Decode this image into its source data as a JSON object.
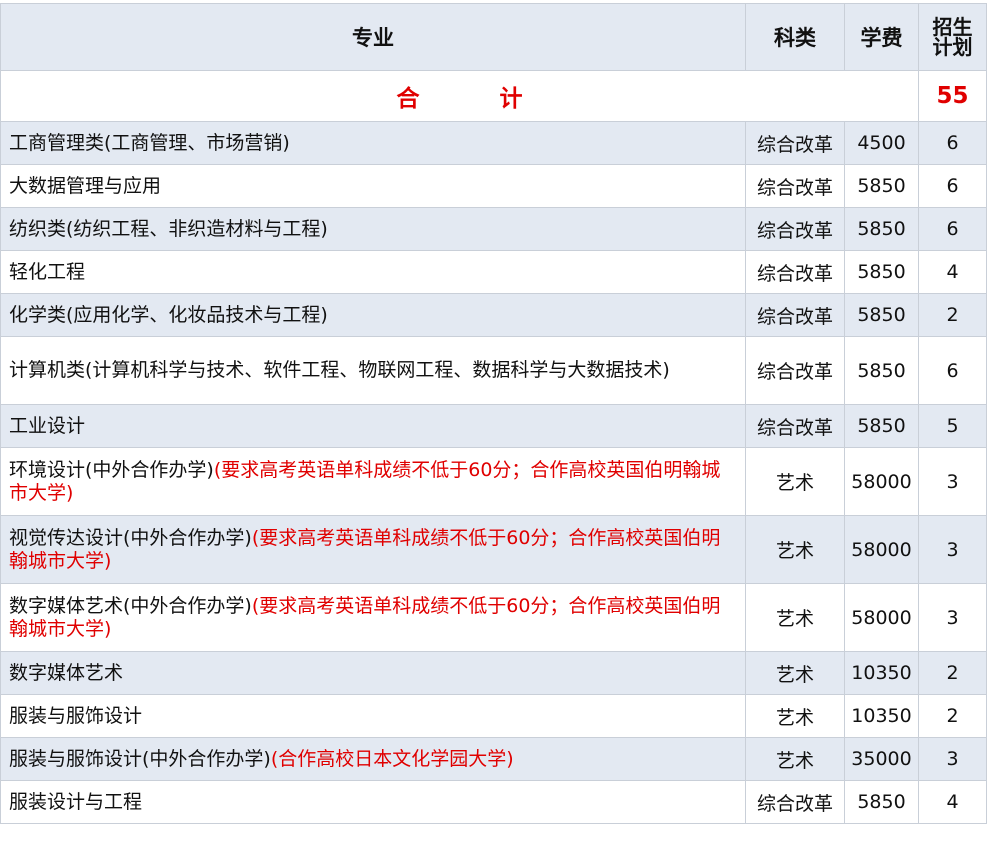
{
  "header": {
    "major": "专业",
    "category": "科类",
    "fee": "学费",
    "plan_line1": "招生",
    "plan_line2": "计划"
  },
  "total": {
    "label": "合计",
    "value": "55"
  },
  "rows": [
    {
      "major": "工商管理类(工商管理、市场营销)",
      "note": "",
      "category": "综合改革",
      "fee": "4500",
      "plan": "6"
    },
    {
      "major": "大数据管理与应用",
      "note": "",
      "category": "综合改革",
      "fee": "5850",
      "plan": "6"
    },
    {
      "major": "纺织类(纺织工程、非织造材料与工程)",
      "note": "",
      "category": "综合改革",
      "fee": "5850",
      "plan": "6"
    },
    {
      "major": "轻化工程",
      "note": "",
      "category": "综合改革",
      "fee": "5850",
      "plan": "4"
    },
    {
      "major": "化学类(应用化学、化妆品技术与工程)",
      "note": "",
      "category": "综合改革",
      "fee": "5850",
      "plan": "2"
    },
    {
      "major": "计算机类(计算机科学与技术、软件工程、物联网工程、数据科学与大数据技术)",
      "note": "",
      "category": "综合改革",
      "fee": "5850",
      "plan": "6"
    },
    {
      "major": "工业设计",
      "note": "",
      "category": "综合改革",
      "fee": "5850",
      "plan": "5"
    },
    {
      "major": "环境设计(中外合作办学)",
      "note": "(要求高考英语单科成绩不低于60分；合作高校英国伯明翰城市大学)",
      "category": "艺术",
      "fee": "58000",
      "plan": "3"
    },
    {
      "major": "视觉传达设计(中外合作办学)",
      "note": "(要求高考英语单科成绩不低于60分；合作高校英国伯明翰城市大学)",
      "category": "艺术",
      "fee": "58000",
      "plan": "3"
    },
    {
      "major": "数字媒体艺术(中外合作办学)",
      "note": "(要求高考英语单科成绩不低于60分；合作高校英国伯明翰城市大学)",
      "category": "艺术",
      "fee": "58000",
      "plan": "3"
    },
    {
      "major": "数字媒体艺术",
      "note": "",
      "category": "艺术",
      "fee": "10350",
      "plan": "2"
    },
    {
      "major": "服装与服饰设计",
      "note": "",
      "category": "艺术",
      "fee": "10350",
      "plan": "2"
    },
    {
      "major": "服装与服饰设计(中外合作办学)",
      "note": "(合作高校日本文化学园大学)",
      "category": "艺术",
      "fee": "35000",
      "plan": "3"
    },
    {
      "major": "服装设计与工程",
      "note": "",
      "category": "综合改革",
      "fee": "5850",
      "plan": "4"
    }
  ]
}
